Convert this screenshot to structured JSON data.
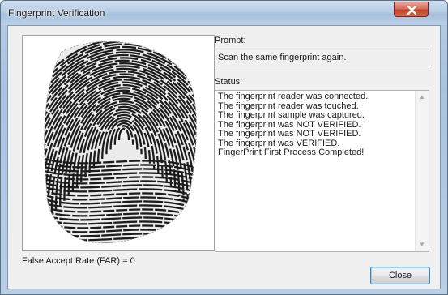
{
  "window": {
    "title": "Fingerprint Verification"
  },
  "fingerprint": {
    "icon": "fingerprint-image"
  },
  "far": {
    "text": "False Accept Rate (FAR) = 0"
  },
  "prompt": {
    "label": "Prompt:",
    "value": "Scan the same fingerprint again."
  },
  "status": {
    "label": "Status:",
    "lines": [
      "The fingerprint reader was connected.",
      "The fingerprint reader was touched.",
      "The fingerprint sample was captured.",
      "The fingerprint was NOT VERIFIED.",
      "The fingerprint was NOT VERIFIED.",
      "The fingerprint was VERIFIED.",
      "FingerPrint First Process Completed!"
    ]
  },
  "buttons": {
    "close_label": "Close"
  },
  "colors": {
    "accent": "#3c7fb1",
    "title_close": "#c5412a"
  }
}
